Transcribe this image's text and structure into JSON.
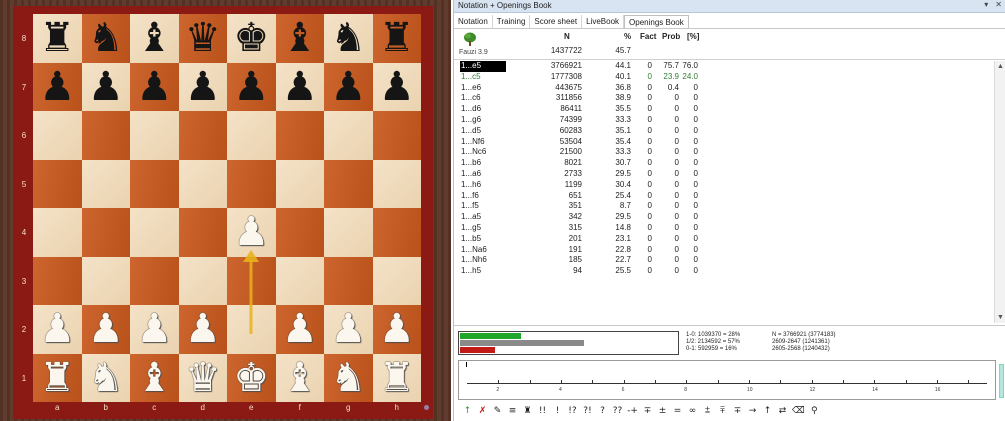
{
  "board": {
    "ranks": [
      "8",
      "7",
      "6",
      "5",
      "4",
      "3",
      "2",
      "1"
    ],
    "files": [
      "a",
      "b",
      "c",
      "d",
      "e",
      "f",
      "g",
      "h"
    ],
    "position": [
      [
        "bR",
        "bN",
        "bB",
        "bQ",
        "bK",
        "bB",
        "bN",
        "bR"
      ],
      [
        "bP",
        "bP",
        "bP",
        "bP",
        "bP",
        "bP",
        "bP",
        "bP"
      ],
      [
        "",
        "",
        "",
        "",
        "",
        "",
        "",
        ""
      ],
      [
        "",
        "",
        "",
        "",
        "",
        "",
        "",
        ""
      ],
      [
        "",
        "",
        "",
        "",
        "wP",
        "",
        "",
        ""
      ],
      [
        "",
        "",
        "",
        "",
        "",
        "",
        "",
        ""
      ],
      [
        "wP",
        "wP",
        "wP",
        "wP",
        "",
        "wP",
        "wP",
        "wP"
      ],
      [
        "wR",
        "wN",
        "wB",
        "wQ",
        "wK",
        "wB",
        "wN",
        "wR"
      ]
    ],
    "last_move": {
      "from": "e2",
      "to": "e4",
      "arrow_color": "#e8b21c"
    },
    "colors": {
      "light": "#f1d9b5",
      "dark": "#c9581d",
      "frame": "#8b1a14"
    }
  },
  "panel": {
    "title": "Notation + Openings Book",
    "title_buttons": [
      "▾",
      "✕"
    ],
    "tabs": [
      "Notation",
      "Training",
      "Score sheet",
      "LiveBook",
      "Openings Book"
    ],
    "active_tab": "Openings Book",
    "header": {
      "n": "N",
      "pct": "%",
      "fact": "Fact",
      "prob": "Prob",
      "p2": "[%]"
    },
    "book_name": "Fauzi 3.9",
    "total_n": "1437722",
    "total_pct": "45.7",
    "moves": [
      {
        "move": "1...e5",
        "n": "3766921",
        "pct": "44.1",
        "fact": "0",
        "prob": "75.7",
        "p2": "76.0",
        "state": "selected"
      },
      {
        "move": "1...c5",
        "n": "1777308",
        "pct": "40.1",
        "fact": "0",
        "prob": "23.9",
        "p2": "24.0",
        "state": "second"
      },
      {
        "move": "1...e6",
        "n": "443675",
        "pct": "36.8",
        "fact": "0",
        "prob": "0.4",
        "p2": "0",
        "state": ""
      },
      {
        "move": "1...c6",
        "n": "311856",
        "pct": "38.9",
        "fact": "0",
        "prob": "0",
        "p2": "0",
        "state": ""
      },
      {
        "move": "1...d6",
        "n": "86411",
        "pct": "35.5",
        "fact": "0",
        "prob": "0",
        "p2": "0",
        "state": ""
      },
      {
        "move": "1...g6",
        "n": "74399",
        "pct": "33.3",
        "fact": "0",
        "prob": "0",
        "p2": "0",
        "state": ""
      },
      {
        "move": "1...d5",
        "n": "60283",
        "pct": "35.1",
        "fact": "0",
        "prob": "0",
        "p2": "0",
        "state": ""
      },
      {
        "move": "1...Nf6",
        "n": "53504",
        "pct": "35.4",
        "fact": "0",
        "prob": "0",
        "p2": "0",
        "state": ""
      },
      {
        "move": "1...Nc6",
        "n": "21500",
        "pct": "33.3",
        "fact": "0",
        "prob": "0",
        "p2": "0",
        "state": ""
      },
      {
        "move": "1...b6",
        "n": "8021",
        "pct": "30.7",
        "fact": "0",
        "prob": "0",
        "p2": "0",
        "state": ""
      },
      {
        "move": "1...a6",
        "n": "2733",
        "pct": "29.5",
        "fact": "0",
        "prob": "0",
        "p2": "0",
        "state": ""
      },
      {
        "move": "1...h6",
        "n": "1199",
        "pct": "30.4",
        "fact": "0",
        "prob": "0",
        "p2": "0",
        "state": ""
      },
      {
        "move": "1...f6",
        "n": "651",
        "pct": "25.4",
        "fact": "0",
        "prob": "0",
        "p2": "0",
        "state": ""
      },
      {
        "move": "1...f5",
        "n": "351",
        "pct": "8.7",
        "fact": "0",
        "prob": "0",
        "p2": "0",
        "state": ""
      },
      {
        "move": "1...a5",
        "n": "342",
        "pct": "29.5",
        "fact": "0",
        "prob": "0",
        "p2": "0",
        "state": ""
      },
      {
        "move": "1...g5",
        "n": "315",
        "pct": "14.8",
        "fact": "0",
        "prob": "0",
        "p2": "0",
        "state": ""
      },
      {
        "move": "1...b5",
        "n": "201",
        "pct": "23.1",
        "fact": "0",
        "prob": "0",
        "p2": "0",
        "state": ""
      },
      {
        "move": "1...Na6",
        "n": "191",
        "pct": "22.8",
        "fact": "0",
        "prob": "0",
        "p2": "0",
        "state": ""
      },
      {
        "move": "1...Nh6",
        "n": "185",
        "pct": "22.7",
        "fact": "0",
        "prob": "0",
        "p2": "0",
        "state": ""
      },
      {
        "move": "1...h5",
        "n": "94",
        "pct": "25.5",
        "fact": "0",
        "prob": "0",
        "p2": "0",
        "state": ""
      }
    ],
    "stats": {
      "win_fraction": 0.28,
      "draw_fraction": 0.57,
      "loss_fraction": 0.16,
      "win_text": "1-0: 1039370 = 28%",
      "draw_text": "1/2: 2134592 = 57%",
      "loss_text": "0-1: 592959 = 16%",
      "n_text": "N = 3766921 (3774183)",
      "elo_text_1": "2609-2647 (1241361)",
      "elo_text_2": "2605-2568 (1240432)",
      "colors": {
        "win": "#21a62b",
        "draw": "#8a8a8a",
        "loss": "#c21b16"
      }
    },
    "timeline_ticks": [
      "2",
      "4",
      "6",
      "8",
      "10",
      "12",
      "14",
      "16"
    ],
    "annotations": [
      {
        "sym": "↑",
        "cls": "green",
        "icon": "arrow-up-icon"
      },
      {
        "sym": "✗",
        "cls": "red",
        "icon": "cross-icon"
      },
      {
        "sym": "✎",
        "cls": "",
        "icon": "pencil-icon"
      },
      {
        "sym": "≡",
        "cls": "",
        "icon": "comment-icon"
      },
      {
        "sym": "♜",
        "cls": "",
        "icon": "board-icon"
      },
      {
        "sym": "!!",
        "cls": "",
        "icon": "brilliant-icon"
      },
      {
        "sym": "!",
        "cls": "",
        "icon": "good-move-icon"
      },
      {
        "sym": "!?",
        "cls": "",
        "icon": "interesting-icon"
      },
      {
        "sym": "?!",
        "cls": "",
        "icon": "dubious-icon"
      },
      {
        "sym": "?",
        "cls": "",
        "icon": "mistake-icon"
      },
      {
        "sym": "??",
        "cls": "",
        "icon": "blunder-icon"
      },
      {
        "sym": "-+",
        "cls": "",
        "icon": "black-winning-icon"
      },
      {
        "sym": "∓",
        "cls": "",
        "icon": "black-better-icon"
      },
      {
        "sym": "±",
        "cls": "",
        "icon": "white-better-icon"
      },
      {
        "sym": "=",
        "cls": "",
        "icon": "equal-icon"
      },
      {
        "sym": "∞",
        "cls": "",
        "icon": "unclear-icon"
      },
      {
        "sym": "⩲",
        "cls": "",
        "icon": "slight-white-icon"
      },
      {
        "sym": "⩱",
        "cls": "",
        "icon": "slight-black-icon"
      },
      {
        "sym": "∓",
        "cls": "",
        "icon": "black-slight-icon"
      },
      {
        "sym": "→",
        "cls": "",
        "icon": "attack-icon"
      },
      {
        "sym": "↑",
        "cls": "",
        "icon": "initiative-icon"
      },
      {
        "sym": "⇄",
        "cls": "",
        "icon": "counterplay-icon"
      },
      {
        "sym": "⌫",
        "cls": "",
        "icon": "eraser-icon"
      },
      {
        "sym": "⚲",
        "cls": "",
        "icon": "pin-icon"
      }
    ]
  }
}
